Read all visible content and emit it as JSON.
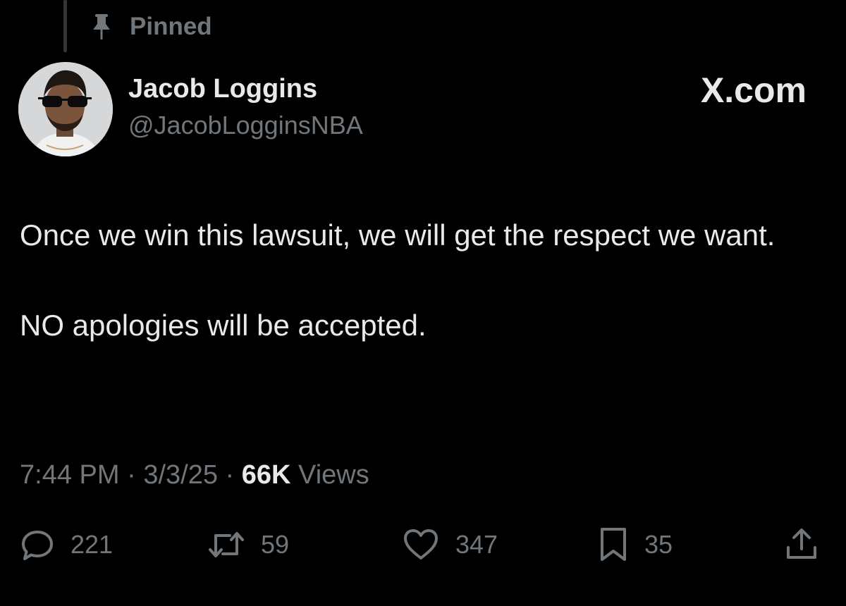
{
  "pinned_label": "Pinned",
  "author": {
    "name": "Jacob Loggins",
    "handle": "@JacobLogginsNBA"
  },
  "brand": "X.com",
  "tweet": {
    "paragraphs": [
      "Once we win this lawsuit, we will get the respect we want.",
      "NO apologies will be accepted."
    ]
  },
  "meta": {
    "time": "7:44 PM",
    "separator": "·",
    "date": "3/3/25",
    "views_count": "66K",
    "views_label": "Views"
  },
  "actions": {
    "replies": "221",
    "reposts": "59",
    "likes": "347",
    "bookmarks": "35"
  },
  "icons": {
    "pinned": "pin-icon",
    "reply": "reply-icon",
    "repost": "repost-icon",
    "like": "heart-icon",
    "bookmark": "bookmark-icon",
    "share": "share-icon"
  },
  "colors": {
    "background": "#000000",
    "primary_text": "#e7e9ea",
    "secondary_text": "#71767b"
  }
}
